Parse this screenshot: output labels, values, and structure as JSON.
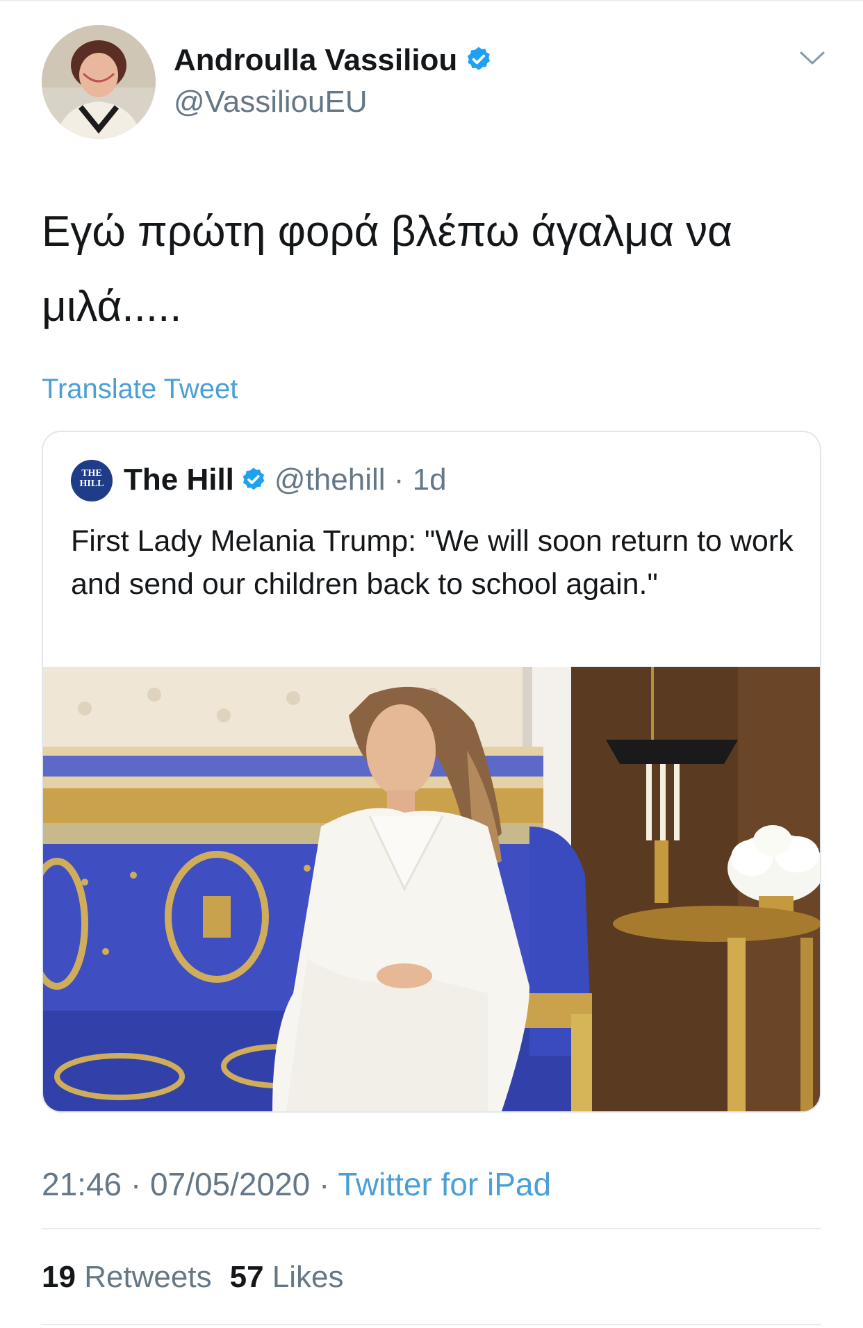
{
  "tweet": {
    "author": {
      "name": "Androulla Vassiliou",
      "handle": "@VassiliouEU",
      "verified": true
    },
    "text": "Εγώ πρώτη φορά βλέπω άγαλμα να μιλά.....",
    "translate_label": "Translate Tweet",
    "quoted": {
      "avatar_text": "THE HILL",
      "name": "The Hill",
      "handle": "@thehill",
      "separator": " · ",
      "age": "1d",
      "verified": true,
      "text": "First Lady Melania Trump: \"We will soon return to work and send our children back to school again.\""
    },
    "time": "21:46",
    "date": "07/05/2020",
    "meta_separator": " · ",
    "source": "Twitter for iPad",
    "retweets_count": "19",
    "retweets_label": "Retweets",
    "likes_count": "57",
    "likes_label": "Likes"
  },
  "colors": {
    "link": "#4a9fd6",
    "verified": "#1da1f2",
    "secondary_text": "#657786",
    "border": "#e1e8ed"
  },
  "icons": {
    "verified": "verified-badge-icon",
    "caret": "chevron-down-icon"
  }
}
